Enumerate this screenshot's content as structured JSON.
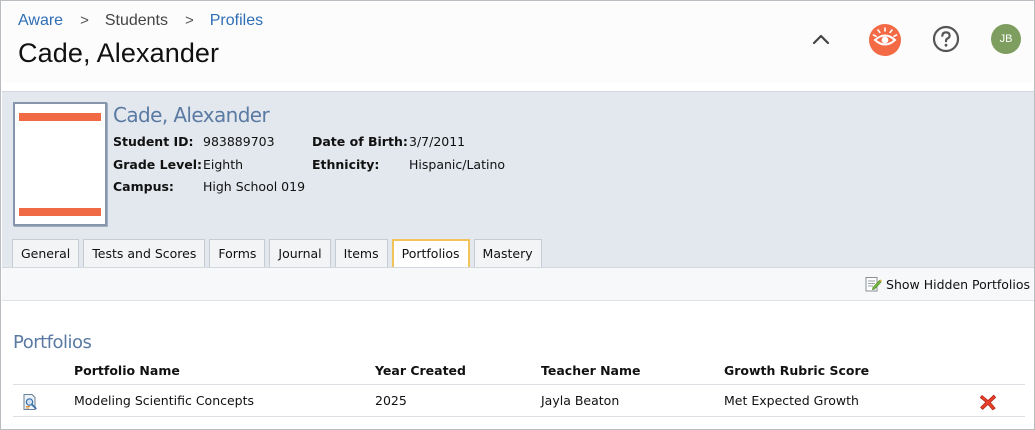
{
  "breadcrumb": [
    {
      "label": "Aware",
      "link": true
    },
    {
      "label": "Students",
      "link": false
    },
    {
      "label": "Profiles",
      "link": true
    }
  ],
  "page_title": "Cade, Alexander",
  "header_icons": [
    "chevron-up-icon",
    "aware-eye-icon",
    "help-icon"
  ],
  "user_avatar": "JB",
  "student": {
    "name": "Cade, Alexander",
    "fields": {
      "student_id": {
        "label": "Student ID:",
        "value": "983889703"
      },
      "grade_level": {
        "label": "Grade Level:",
        "value": "Eighth"
      },
      "campus": {
        "label": "Campus:",
        "value": "High School 019"
      },
      "dob": {
        "label": "Date of Birth:",
        "value": "3/7/2011"
      },
      "ethnicity": {
        "label": "Ethnicity:",
        "value": "Hispanic/Latino"
      }
    }
  },
  "tabs": [
    {
      "label": "General"
    },
    {
      "label": "Tests and Scores"
    },
    {
      "label": "Forms"
    },
    {
      "label": "Journal"
    },
    {
      "label": "Items"
    },
    {
      "label": "Portfolios",
      "active": true
    },
    {
      "label": "Mastery"
    }
  ],
  "toolbar": {
    "show_hidden": "Show Hidden Portfolios"
  },
  "portfolios": {
    "title": "Portfolios",
    "columns": [
      "Portfolio Name",
      "Year Created",
      "Teacher Name",
      "Growth Rubric Score"
    ],
    "rows": [
      {
        "name": "Modeling Scientific Concepts",
        "year": "2025",
        "teacher": "Jayla Beaton",
        "score": "Met Expected Growth"
      }
    ]
  },
  "colors": {
    "accent_blue": "#2f6eb5",
    "brand_orange": "#f46a45",
    "avatar_green": "#7e9e60",
    "active_tab_border": "#f2c25b",
    "delete_red": "#e8402a"
  }
}
